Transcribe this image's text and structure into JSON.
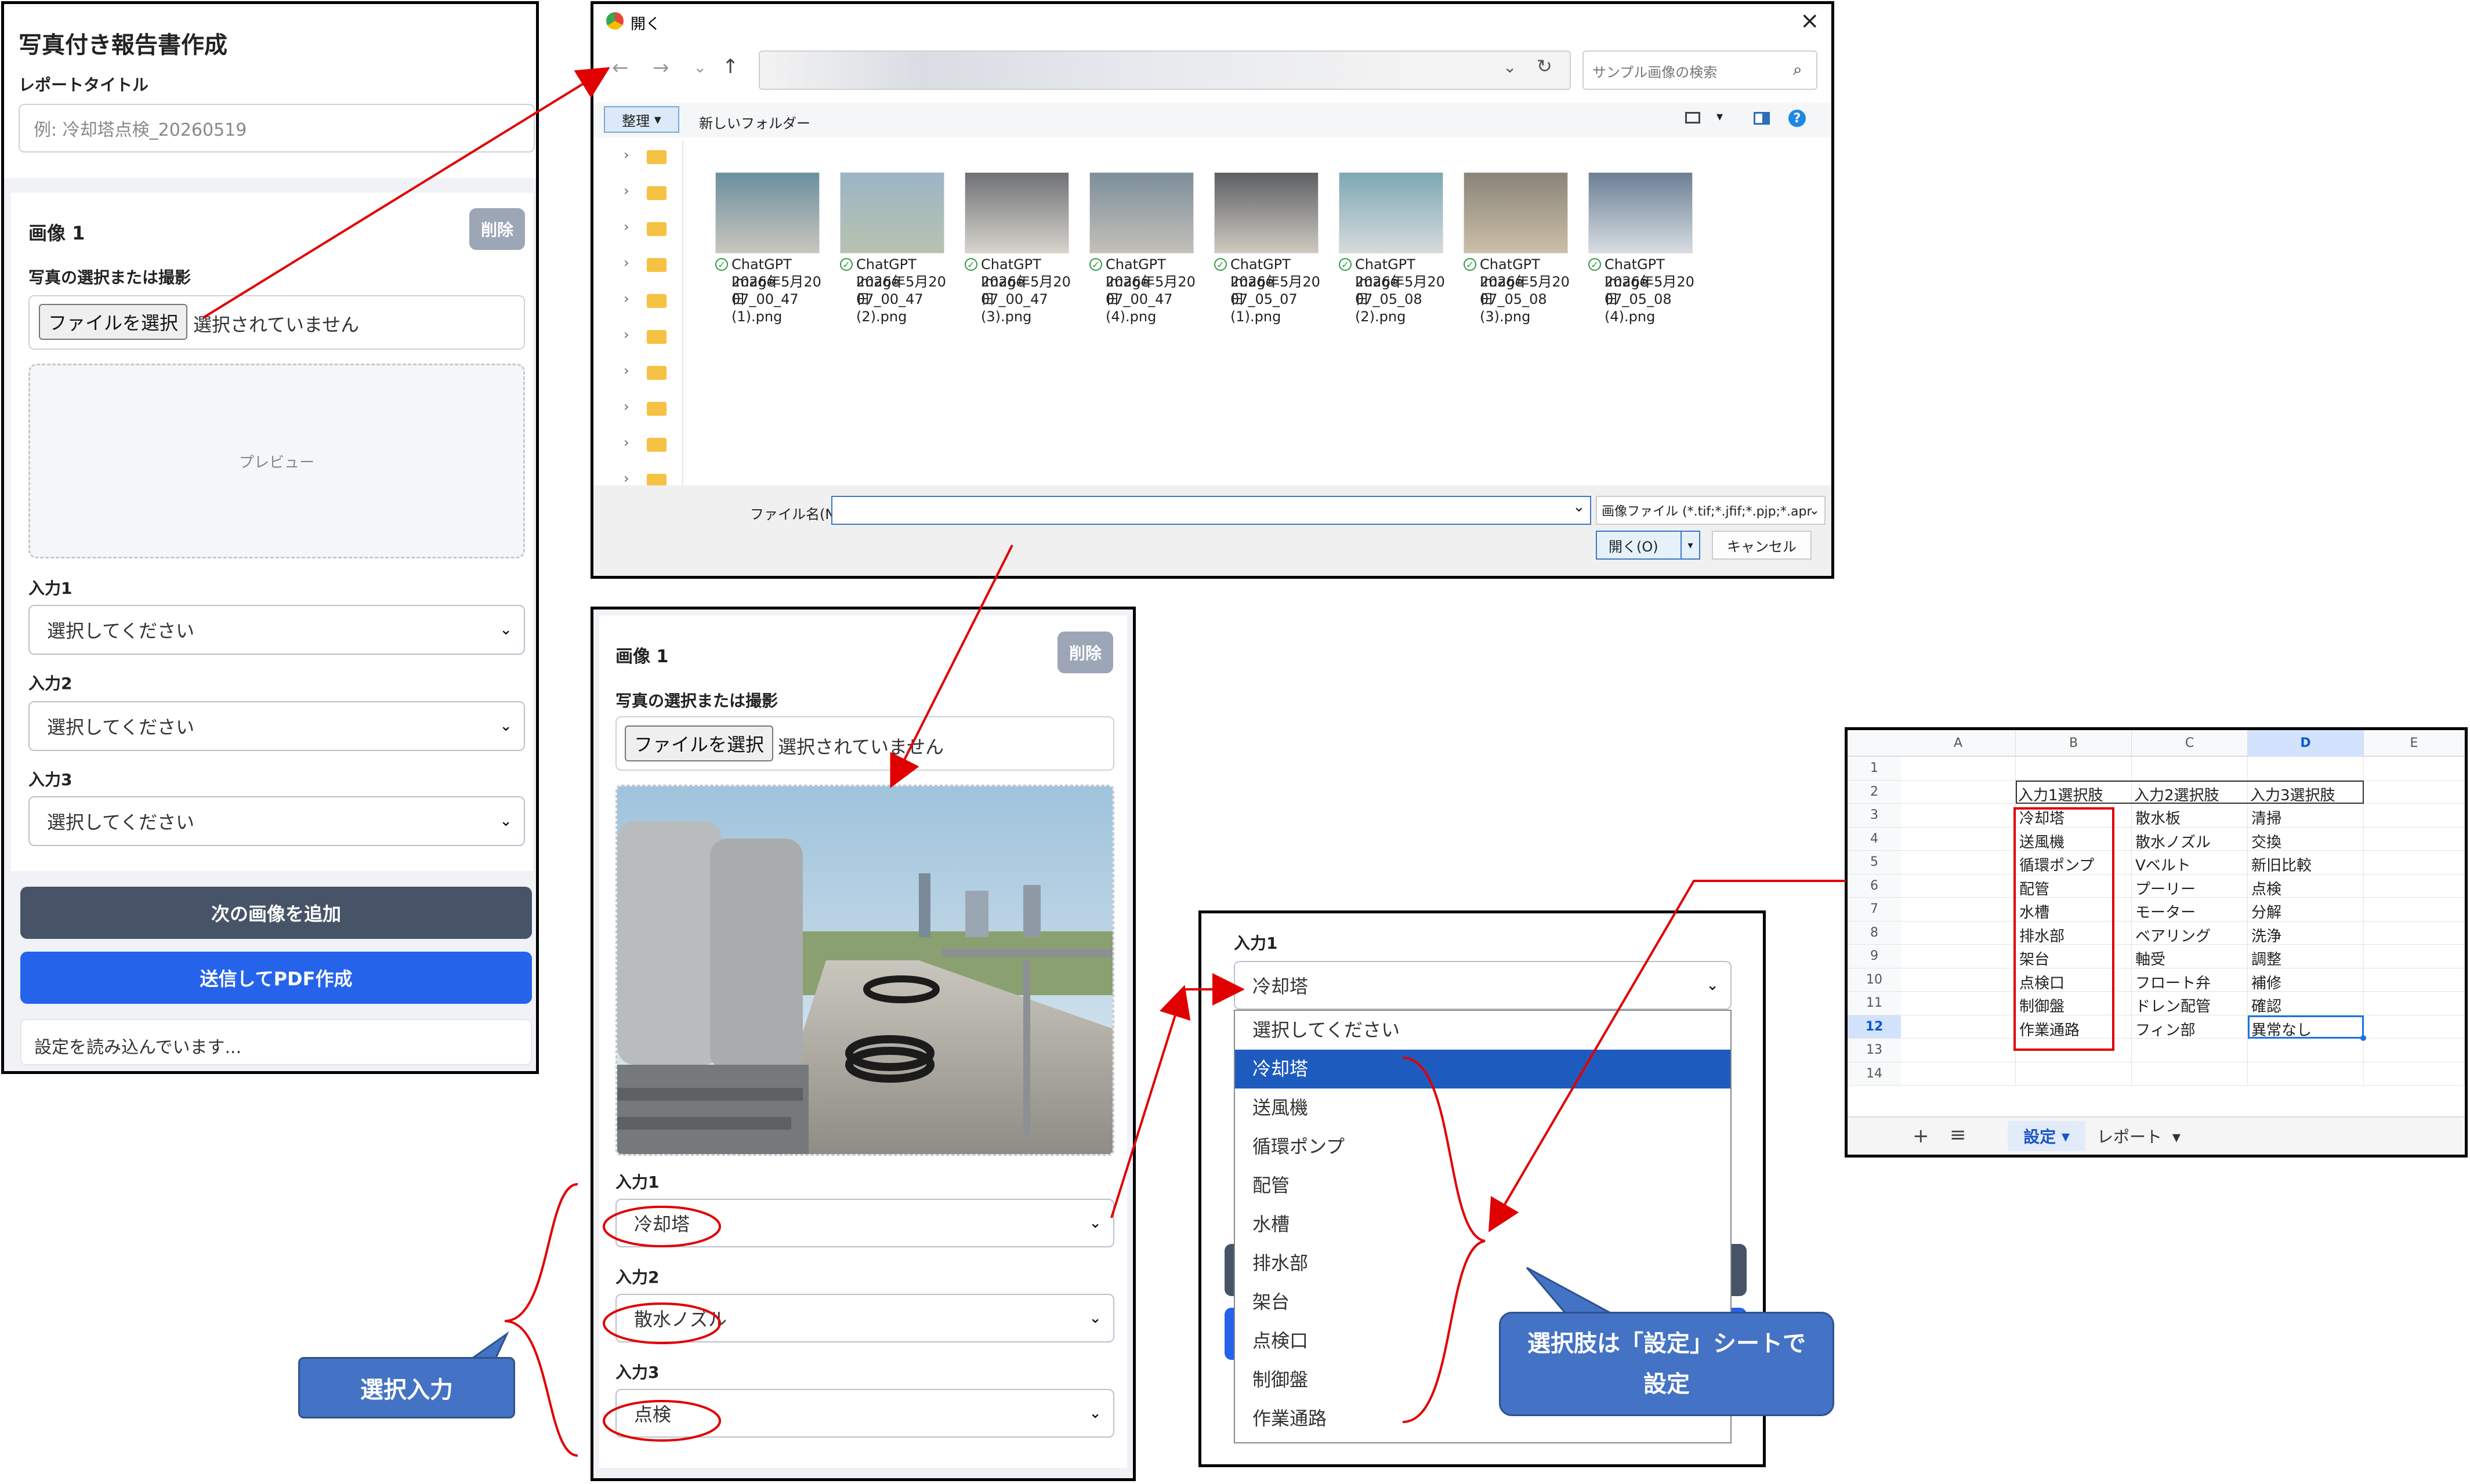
{
  "form": {
    "title": "写真付き報告書作成",
    "report_title_label": "レポートタイトル",
    "report_title_placeholder": "例: 冷却塔点検_20260519",
    "image_label": "画像 1",
    "delete_label": "削除",
    "photo_label": "写真の選択または撮影",
    "file_button": "ファイルを選択",
    "file_status": "選択されていません",
    "preview_text": "プレビュー",
    "input1_label": "入力1",
    "input2_label": "入力2",
    "input3_label": "入力3",
    "select_placeholder": "選択してください",
    "add_button": "次の画像を追加",
    "submit_button": "送信してPDF作成",
    "status_text": "設定を読み込んでいます..."
  },
  "dialog": {
    "title": "開く",
    "search_placeholder": "サンプル画像の検索",
    "organize": "整理",
    "new_folder": "新しいフォルダー",
    "files": [
      {
        "l1": "ChatGPT Image",
        "l2": "2026年5月20日",
        "l3": "07_00_47",
        "l4": "(1).png"
      },
      {
        "l1": "ChatGPT Image",
        "l2": "2026年5月20日",
        "l3": "07_00_47",
        "l4": "(2).png"
      },
      {
        "l1": "ChatGPT Image",
        "l2": "2026年5月20日",
        "l3": "07_00_47",
        "l4": "(3).png"
      },
      {
        "l1": "ChatGPT Image",
        "l2": "2026年5月20日",
        "l3": "07_00_47",
        "l4": "(4).png"
      },
      {
        "l1": "ChatGPT Image",
        "l2": "2026年5月20日",
        "l3": "07_05_07",
        "l4": "(1).png"
      },
      {
        "l1": "ChatGPT Image",
        "l2": "2026年5月20日",
        "l3": "07_05_08",
        "l4": "(2).png"
      },
      {
        "l1": "ChatGPT Image",
        "l2": "2026年5月20日",
        "l3": "07_05_08",
        "l4": "(3).png"
      },
      {
        "l1": "ChatGPT Image",
        "l2": "2026年5月20日",
        "l3": "07_05_08",
        "l4": "(4).png"
      }
    ],
    "filename_label": "ファイル名(N):",
    "filter": "画像ファイル (*.tif;*.jfif;*.pjp;*.apr",
    "open_button": "開く(O)",
    "cancel_button": "キャンセル"
  },
  "form2": {
    "image_label": "画像 1",
    "delete_label": "削除",
    "photo_label": "写真の選択または撮影",
    "file_button": "ファイルを選択",
    "file_status": "選択されていません",
    "input1_label": "入力1",
    "input1_value": "冷却塔",
    "input2_label": "入力2",
    "input2_value": "散水ノズル",
    "input3_label": "入力3",
    "input3_value": "点検"
  },
  "dropdown": {
    "label": "入力1",
    "selected": "冷却塔",
    "options": [
      "選択してください",
      "冷却塔",
      "送風機",
      "循環ポンプ",
      "配管",
      "水槽",
      "排水部",
      "架台",
      "点検口",
      "制御盤",
      "作業通路"
    ]
  },
  "sheet": {
    "columns": [
      "A",
      "B",
      "C",
      "D",
      "E"
    ],
    "rows": [
      "1",
      "2",
      "3",
      "4",
      "5",
      "6",
      "7",
      "8",
      "9",
      "10",
      "11",
      "12",
      "13",
      "14"
    ],
    "header": [
      "入力1選択肢",
      "入力2選択肢",
      "入力3選択肢"
    ],
    "data": [
      [
        "冷却塔",
        "散水板",
        "清掃"
      ],
      [
        "送風機",
        "散水ノズル",
        "交換"
      ],
      [
        "循環ポンプ",
        "Vベルト",
        "新旧比較"
      ],
      [
        "配管",
        "プーリー",
        "点検"
      ],
      [
        "水槽",
        "モーター",
        "分解"
      ],
      [
        "排水部",
        "ベアリング",
        "洗浄"
      ],
      [
        "架台",
        "軸受",
        "調整"
      ],
      [
        "点検口",
        "フロート弁",
        "補修"
      ],
      [
        "制御盤",
        "ドレン配管",
        "確認"
      ],
      [
        "作業通路",
        "フィン部",
        "異常なし"
      ]
    ],
    "tabs": [
      "設定",
      "レポート"
    ],
    "plus": "+",
    "menu_icon": "≡"
  },
  "callouts": {
    "select_input": "選択入力",
    "settings_line1": "選択肢は「設定」シートで",
    "settings_line2": "設定"
  },
  "colors": {
    "primary": "#2563eb",
    "dark_button": "#475467",
    "annotation": "#e00000",
    "callout": "#4472c4"
  }
}
